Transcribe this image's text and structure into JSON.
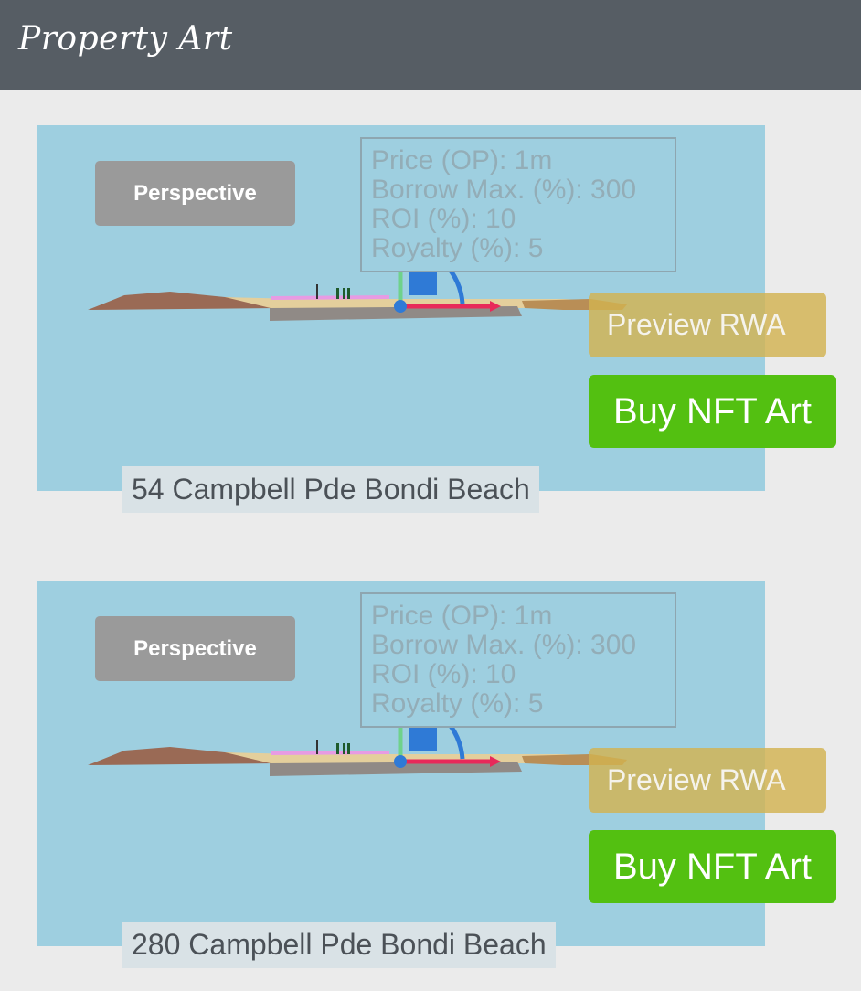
{
  "header": {
    "title": "Property Art"
  },
  "listings": [
    {
      "view_label": "Perspective",
      "stats": [
        "Price (OP): 1m",
        "Borrow Max. (%): 300",
        "ROI (%): 10",
        "Royalty (%): 5"
      ],
      "preview_label": "Preview RWA",
      "buy_label": "Buy NFT Art",
      "address": "54 Campbell Pde Bondi Beach"
    },
    {
      "view_label": "Perspective",
      "stats": [
        "Price (OP): 1m",
        "Borrow Max. (%): 300",
        "ROI (%): 10",
        "Royalty (%): 5"
      ],
      "preview_label": "Preview RWA",
      "buy_label": "Buy NFT Art",
      "address": "280 Campbell Pde Bondi Beach"
    }
  ],
  "colors": {
    "header_bg": "#565d64",
    "card_bg": "#9ecfe0",
    "buy_button": "#53c011",
    "preview_button": "#d2b250",
    "axis_x": "#e8295a",
    "axis_y": "#6fd28b",
    "axis_rotate": "#2f7ad6"
  }
}
